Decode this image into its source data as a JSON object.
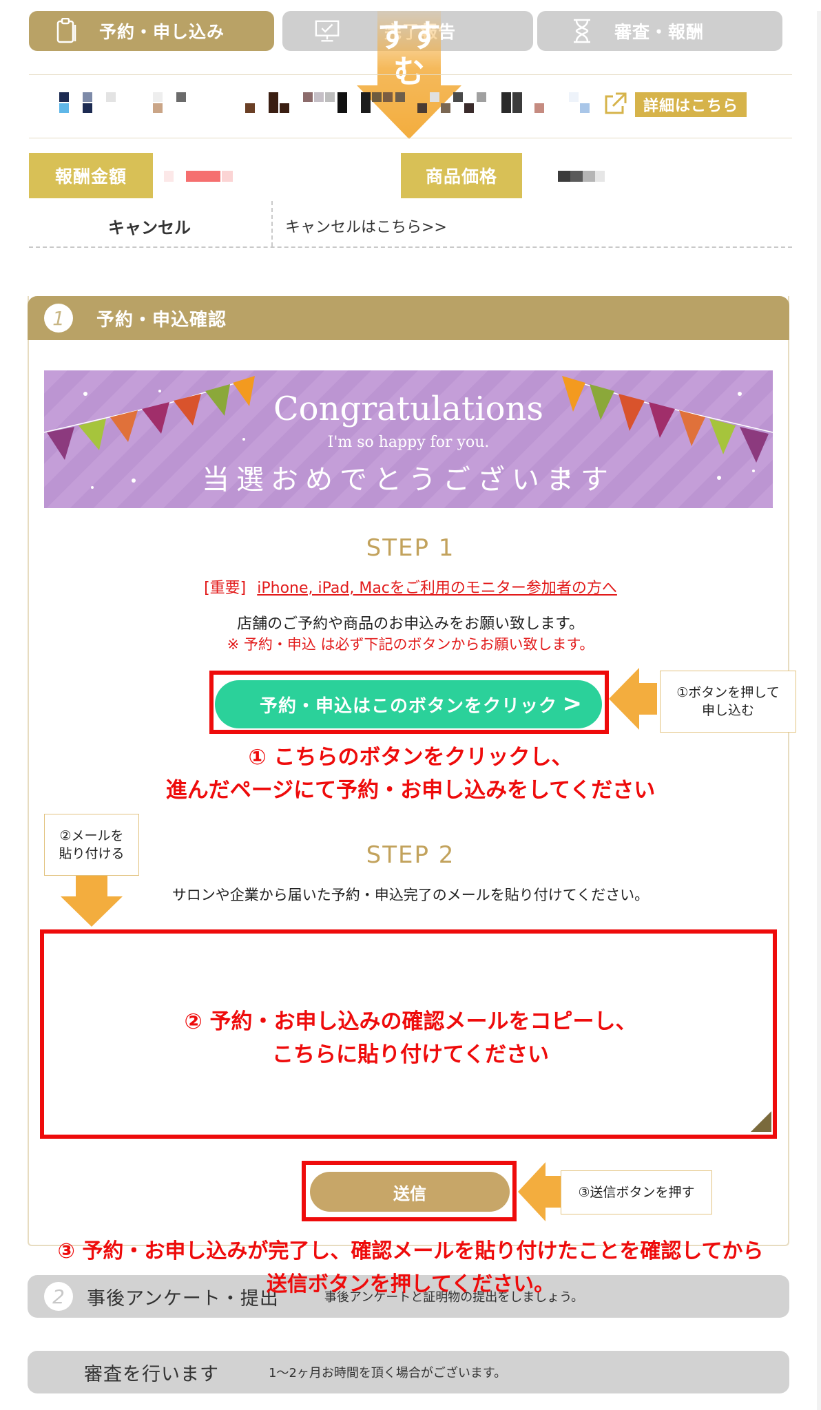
{
  "tabs": [
    {
      "label": "予約・申し込み",
      "state": "active",
      "icon": "clipboard-icon"
    },
    {
      "label": "完了報告",
      "state": "inactive",
      "icon": "monitor-icon"
    },
    {
      "label": "審査・報酬",
      "state": "inactive",
      "icon": "hourglass-icon"
    }
  ],
  "overlay_arrow": {
    "text": "すすむ"
  },
  "product": {
    "detail_label": "詳細はこちら"
  },
  "price_row": {
    "reward_label": "報酬金額",
    "price_label": "商品価格"
  },
  "cancel_row": {
    "label": "キャンセル",
    "link": "キャンセルはこちら>>"
  },
  "section1": {
    "num": "1",
    "title": "予約・申込確認",
    "banner": {
      "title": "Congratulations",
      "sub": "I'm so happy for you.",
      "jp": "当選おめでとうございます"
    },
    "step1": {
      "heading": "STEP 1",
      "important_tag": "[重要]",
      "important_link": "iPhone, iPad, Macをご利用のモニター参加者の方へ",
      "desc": "店舗のご予約や商品のお申込みをお願い致します。",
      "note": "※ 予約・申込 は必ず下記のボタンからお願い致します。",
      "button": "予約・申込はこのボタンをクリック",
      "chevron": ">",
      "callout": [
        "①ボタンを押して",
        "申し込む"
      ],
      "instruction": [
        "① こちらのボタンをクリックし、",
        "進んだページにて予約・お申し込みをしてください"
      ]
    },
    "step2": {
      "heading": "STEP 2",
      "callout": [
        "②メールを",
        "貼り付ける"
      ],
      "desc": "サロンや企業から届いた予約・申込完了のメールを貼り付けてください。",
      "instruction": [
        "② 予約・お申し込みの確認メールをコピーし、",
        "こちらに貼り付けてください"
      ]
    },
    "send": {
      "button": "送信",
      "callout": "③送信ボタンを押す",
      "instruction": [
        "③ 予約・お申し込みが完了し、確認メールを貼り付けたことを確認してから",
        "送信ボタンを押してください。"
      ]
    }
  },
  "section2": {
    "num": "2",
    "title": "事後アンケート・提出",
    "sub": "事後アンケートと証明物の提出をしましょう。"
  },
  "section3": {
    "title": "審査を行います",
    "sub": "1～2ヶ月お時間を頂く場合がございます。"
  },
  "colors": {
    "gold": "#b9a266",
    "green": "#2bd19a",
    "red": "#ee0b0b",
    "orange": "#f3ad3e",
    "grey": "#d2d2d2"
  }
}
